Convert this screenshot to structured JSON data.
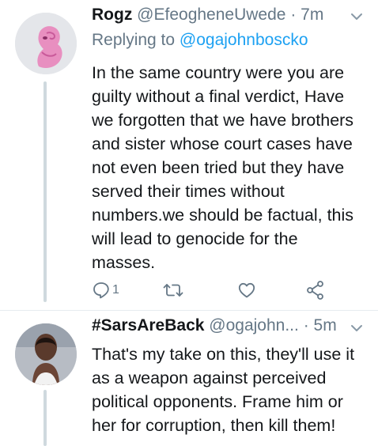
{
  "tweets": [
    {
      "name": "Rogz",
      "handle": "@EfeogheneUwede",
      "separator": "·",
      "time": "7m",
      "replying_prefix": "Replying to",
      "replying_to": "@ogajohnboscko",
      "text": "In the same country were you are\nguilty without a final verdict, Have\nwe forgotten that we have brothers\nand sister whose court cases have\nnot even been tried but they have\nserved their times without\nnumbers.we should be factual, this\nwill lead to genocide for the\nmasses.",
      "reply_count": "1",
      "avatar_icon": "pink-cartoon-avatar"
    },
    {
      "name": "#SarsAreBack",
      "handle": "@ogajohn...",
      "separator": "·",
      "time": "5m",
      "text": "That's my take on this, they'll use it\nas a weapon against perceived\npolitical opponents. Frame him or\nher for corruption, then kill them!",
      "avatar_icon": "profile-photo-avatar"
    }
  ],
  "colors": {
    "accent": "#1da1f2",
    "muted": "#657786",
    "text": "#14171a",
    "divider": "#e6ecf0"
  },
  "icons": [
    "reply-icon",
    "retweet-icon",
    "like-icon",
    "share-icon",
    "chevron-down-icon"
  ]
}
